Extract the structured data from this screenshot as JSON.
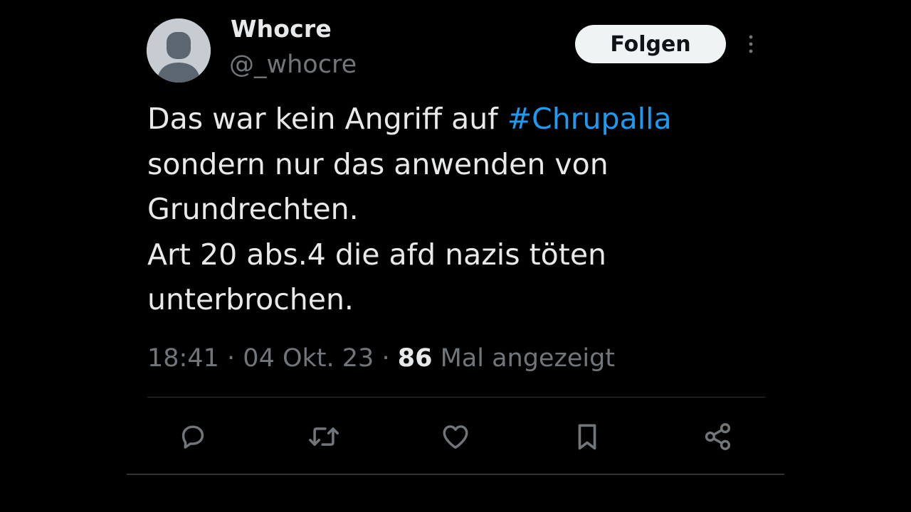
{
  "profile": {
    "display_name": "Whocre",
    "handle": "@_whocre"
  },
  "header": {
    "follow_label": "Folgen"
  },
  "tweet": {
    "lines": [
      {
        "before": "Das war kein Angriff auf ",
        "hashtag": "#Chrupalla"
      },
      {
        "text": "sondern nur das anwenden von"
      },
      {
        "text": "Grundrechten."
      },
      {
        "text": "Art 20 abs.4 die afd nazis töten"
      },
      {
        "text": "unterbrochen."
      }
    ]
  },
  "meta": {
    "time": "18:41",
    "separator": "·",
    "date": "04 Okt. 23",
    "views_count": "86",
    "views_label": "Mal angezeigt"
  },
  "actions": [
    {
      "icon": "reply-icon"
    },
    {
      "icon": "retweet-icon"
    },
    {
      "icon": "like-icon"
    },
    {
      "icon": "bookmark-icon"
    },
    {
      "icon": "share-icon"
    }
  ],
  "colors": {
    "background": "#000000",
    "text_primary": "#e7e9ea",
    "text_secondary": "#71767b",
    "hashtag": "#1d9bf0",
    "follow_button_bg": "#eff3f4",
    "divider": "#2f3336"
  }
}
